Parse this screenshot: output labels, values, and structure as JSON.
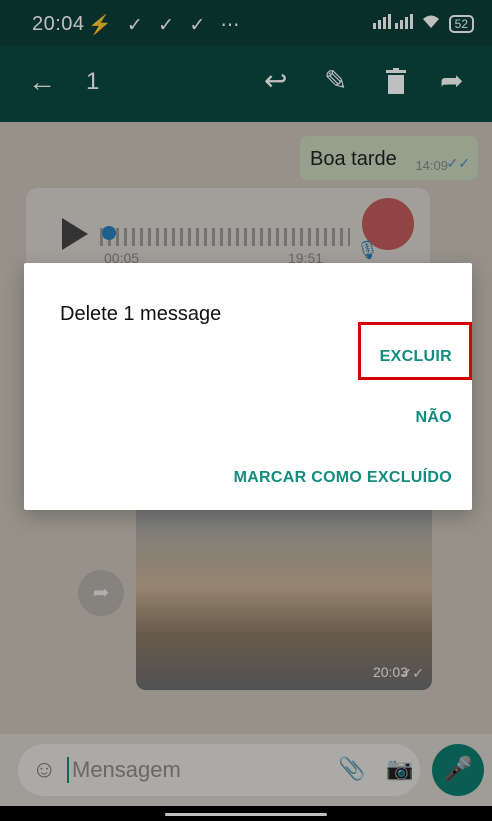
{
  "status_bar": {
    "time": "20:04",
    "left_icons": "⚡ ✓ ✓ ✓ ⋯",
    "signal": "᯾",
    "wifi": "📶",
    "battery": "52"
  },
  "app_bar": {
    "selected_count": "1",
    "back_icon": "arrow-left-icon",
    "actions": [
      {
        "icon": "reply-icon",
        "glyph": "↩"
      },
      {
        "icon": "edit-icon",
        "glyph": "✎"
      },
      {
        "icon": "delete-icon",
        "glyph": "🗑"
      },
      {
        "icon": "forward-icon",
        "glyph": "➦"
      }
    ]
  },
  "chat": {
    "outgoing": {
      "text": "Boa tarde",
      "time": "14:09",
      "status_glyph": "✓✓"
    },
    "voice": {
      "elapsed": "00:05",
      "time": "19:51"
    },
    "photo": {
      "time": "20:03",
      "status_glyph": "✓✓"
    }
  },
  "dialog": {
    "message": "Delete 1 message",
    "buttons": {
      "excluir": "EXCLUIR",
      "nao": "NÃO",
      "marcar": "MARCAR COMO EXCLUÍDO"
    }
  },
  "input": {
    "placeholder": "Mensagem"
  },
  "colors": {
    "accent": "#128c7e",
    "header": "#0b4a42",
    "highlight": "#d60000"
  }
}
